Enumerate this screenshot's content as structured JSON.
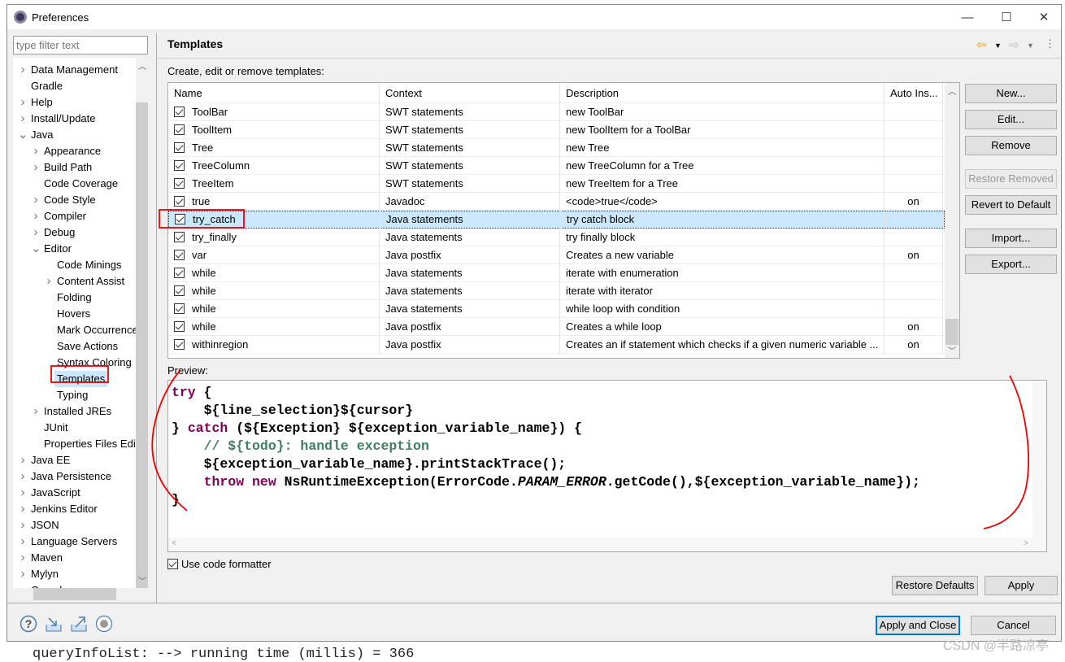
{
  "background": {
    "console_text": "queryInfoList: --> running time (millis) = 366",
    "watermark": "CSDN @半路凉亭"
  },
  "window": {
    "title": "Preferences",
    "minimize": "—",
    "maximize": "☐",
    "close": "✕"
  },
  "filter": {
    "placeholder": "type filter text"
  },
  "tree": [
    {
      "label": "Data Management",
      "level": 0,
      "twisty": "collapsed"
    },
    {
      "label": "Gradle",
      "level": 0,
      "twisty": ""
    },
    {
      "label": "Help",
      "level": 0,
      "twisty": "collapsed"
    },
    {
      "label": "Install/Update",
      "level": 0,
      "twisty": "collapsed"
    },
    {
      "label": "Java",
      "level": 0,
      "twisty": "expanded"
    },
    {
      "label": "Appearance",
      "level": 1,
      "twisty": "collapsed"
    },
    {
      "label": "Build Path",
      "level": 1,
      "twisty": "collapsed"
    },
    {
      "label": "Code Coverage",
      "level": 1,
      "twisty": ""
    },
    {
      "label": "Code Style",
      "level": 1,
      "twisty": "collapsed"
    },
    {
      "label": "Compiler",
      "level": 1,
      "twisty": "collapsed"
    },
    {
      "label": "Debug",
      "level": 1,
      "twisty": "collapsed"
    },
    {
      "label": "Editor",
      "level": 1,
      "twisty": "expanded"
    },
    {
      "label": "Code Minings",
      "level": 2,
      "twisty": ""
    },
    {
      "label": "Content Assist",
      "level": 2,
      "twisty": "collapsed"
    },
    {
      "label": "Folding",
      "level": 2,
      "twisty": ""
    },
    {
      "label": "Hovers",
      "level": 2,
      "twisty": ""
    },
    {
      "label": "Mark Occurrences",
      "level": 2,
      "twisty": ""
    },
    {
      "label": "Save Actions",
      "level": 2,
      "twisty": ""
    },
    {
      "label": "Syntax Coloring",
      "level": 2,
      "twisty": ""
    },
    {
      "label": "Templates",
      "level": 2,
      "twisty": "",
      "selected": true
    },
    {
      "label": "Typing",
      "level": 2,
      "twisty": ""
    },
    {
      "label": "Installed JREs",
      "level": 1,
      "twisty": "collapsed"
    },
    {
      "label": "JUnit",
      "level": 1,
      "twisty": ""
    },
    {
      "label": "Properties Files Editor",
      "level": 1,
      "twisty": ""
    },
    {
      "label": "Java EE",
      "level": 0,
      "twisty": "collapsed"
    },
    {
      "label": "Java Persistence",
      "level": 0,
      "twisty": "collapsed"
    },
    {
      "label": "JavaScript",
      "level": 0,
      "twisty": "collapsed"
    },
    {
      "label": "Jenkins Editor",
      "level": 0,
      "twisty": "collapsed"
    },
    {
      "label": "JSON",
      "level": 0,
      "twisty": "collapsed"
    },
    {
      "label": "Language Servers",
      "level": 0,
      "twisty": "collapsed"
    },
    {
      "label": "Maven",
      "level": 0,
      "twisty": "collapsed"
    },
    {
      "label": "Mylyn",
      "level": 0,
      "twisty": "collapsed"
    },
    {
      "label": "Oomph",
      "level": 0,
      "twisty": "collapsed"
    }
  ],
  "page": {
    "title": "Templates",
    "subtitle": "Create, edit or remove templates:",
    "preview_label": "Preview:",
    "use_formatter": "Use code formatter",
    "use_formatter_checked": true
  },
  "table": {
    "columns": [
      "Name",
      "Context",
      "Description",
      "Auto Ins..."
    ],
    "rows": [
      {
        "checked": true,
        "name": "ToolBar",
        "context": "SWT statements",
        "description": "new ToolBar",
        "auto": ""
      },
      {
        "checked": true,
        "name": "ToolItem",
        "context": "SWT statements",
        "description": "new ToolItem for a ToolBar",
        "auto": ""
      },
      {
        "checked": true,
        "name": "Tree",
        "context": "SWT statements",
        "description": "new Tree",
        "auto": ""
      },
      {
        "checked": true,
        "name": "TreeColumn",
        "context": "SWT statements",
        "description": "new TreeColumn for a Tree",
        "auto": ""
      },
      {
        "checked": true,
        "name": "TreeItem",
        "context": "SWT statements",
        "description": "new TreeItem for a Tree",
        "auto": ""
      },
      {
        "checked": true,
        "name": "true",
        "context": "Javadoc",
        "description": "<code>true</code>",
        "auto": "on"
      },
      {
        "checked": true,
        "name": "try_catch",
        "context": "Java statements",
        "description": "try catch block",
        "auto": "",
        "selected": true
      },
      {
        "checked": true,
        "name": "try_finally",
        "context": "Java statements",
        "description": "try finally block",
        "auto": ""
      },
      {
        "checked": true,
        "name": "var",
        "context": "Java postfix",
        "description": "Creates a new variable",
        "auto": "on"
      },
      {
        "checked": true,
        "name": "while",
        "context": "Java statements",
        "description": "iterate with enumeration",
        "auto": ""
      },
      {
        "checked": true,
        "name": "while",
        "context": "Java statements",
        "description": "iterate with iterator",
        "auto": ""
      },
      {
        "checked": true,
        "name": "while",
        "context": "Java statements",
        "description": "while loop with condition",
        "auto": ""
      },
      {
        "checked": true,
        "name": "while",
        "context": "Java postfix",
        "description": "Creates a while loop",
        "auto": "on"
      },
      {
        "checked": true,
        "name": "withinregion",
        "context": "Java postfix",
        "description": "Creates an if statement which checks if a given numeric variable ...",
        "auto": "on"
      }
    ]
  },
  "side_buttons": {
    "new": "New...",
    "edit": "Edit...",
    "remove": "Remove",
    "restore_removed": "Restore Removed",
    "revert": "Revert to Default",
    "import": "Import...",
    "export": "Export..."
  },
  "preview_code": [
    [
      [
        "kw",
        "try"
      ],
      [
        "",
        "{"
      ]
    ],
    [
      [
        "",
        "    ${line_selection}${cursor}"
      ]
    ],
    [
      [
        "",
        "} "
      ],
      [
        "kw",
        "catch"
      ],
      [
        "",
        " (${Exception} ${exception_variable_name}) {"
      ]
    ],
    [
      [
        "cm",
        "    // ${todo}: handle exception"
      ]
    ],
    [
      [
        "",
        "    ${exception_variable_name}.printStackTrace();"
      ]
    ],
    [
      [
        "",
        "    "
      ],
      [
        "kw",
        "throw"
      ],
      [
        "",
        " "
      ],
      [
        "kw",
        "new"
      ],
      [
        "",
        " NsRuntimeException(ErrorCode."
      ],
      [
        "it2",
        "PARAM_ERROR"
      ],
      [
        "",
        ".getCode(),${exception_variable_name});"
      ]
    ],
    [
      [
        "",
        "}"
      ]
    ]
  ],
  "bottom": {
    "restore_defaults": "Restore Defaults",
    "apply": "Apply",
    "apply_close": "Apply and Close",
    "cancel": "Cancel"
  },
  "colors": {
    "keyword": "#7f0055",
    "comment": "#3f7f5f",
    "selection": "#cce8ff",
    "annotation": "#ff0000",
    "default_button_border": "#0078d7"
  }
}
